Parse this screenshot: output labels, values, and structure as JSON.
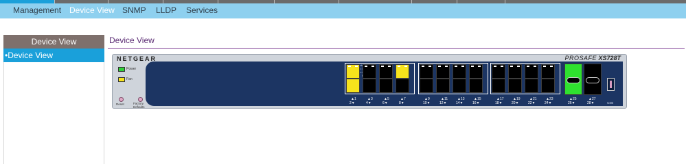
{
  "subnav": {
    "items": [
      {
        "label": "Management",
        "active": false
      },
      {
        "label": "Device View",
        "active": true
      },
      {
        "label": "SNMP",
        "active": false
      },
      {
        "label": "LLDP",
        "active": false
      },
      {
        "label": "Services",
        "active": false
      }
    ]
  },
  "sidebar": {
    "header": "Device View",
    "items": [
      {
        "label": "Device View",
        "selected": true
      }
    ]
  },
  "main": {
    "title": "Device View"
  },
  "device": {
    "brand": "NETGEAR",
    "series": "PROSAFE",
    "model": "XS728T",
    "leds": [
      {
        "label": "Power",
        "color": "#2fd13a"
      },
      {
        "label": "Fan",
        "color": "#f7e31c"
      }
    ],
    "buttons": [
      "Reset",
      "Factory Defaults"
    ],
    "legend": [
      "Link/ACT mode",
      "Green = Link at 10G",
      "Yellow = Link at 1G",
      "Blink = ACT"
    ],
    "usb_label": "USB",
    "port_colors": {
      "up_10g": "#2fe12f",
      "up_1g": "#f7e31c",
      "down": "#000000"
    },
    "port_groups": [
      {
        "top": [
          "1",
          "3",
          "5",
          "7"
        ],
        "bottom": [
          "2",
          "4",
          "6",
          "8"
        ],
        "status_top": [
          "1g",
          "down",
          "down",
          "1g"
        ],
        "status_bottom": [
          "1g",
          "down",
          "down",
          "down"
        ]
      },
      {
        "top": [
          "9",
          "11",
          "13",
          "15"
        ],
        "bottom": [
          "10",
          "12",
          "14",
          "16"
        ],
        "status_top": [
          "down",
          "down",
          "down",
          "down"
        ],
        "status_bottom": [
          "down",
          "down",
          "down",
          "down"
        ]
      },
      {
        "top": [
          "17",
          "19",
          "21",
          "23"
        ],
        "bottom": [
          "18",
          "20",
          "22",
          "24"
        ],
        "status_top": [
          "down",
          "down",
          "down",
          "down"
        ],
        "status_bottom": [
          "down",
          "down",
          "down",
          "down"
        ]
      }
    ],
    "sfp_ports": [
      {
        "top": "25",
        "bottom": "26",
        "status": "10g"
      },
      {
        "top": "27",
        "bottom": "28",
        "status": "down"
      }
    ]
  }
}
